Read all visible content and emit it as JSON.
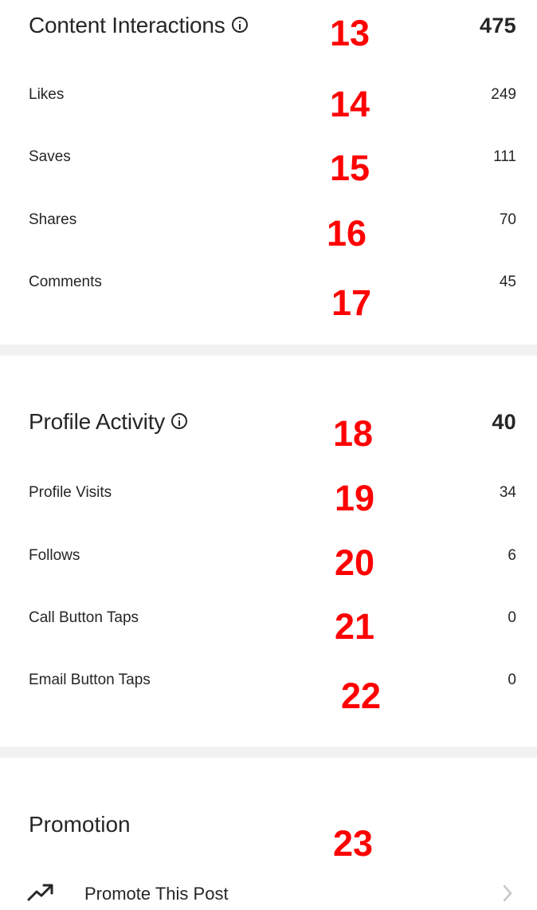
{
  "content_interactions": {
    "title": "Content Interactions",
    "total": "475",
    "items": [
      {
        "label": "Likes",
        "value": "249"
      },
      {
        "label": "Saves",
        "value": "111"
      },
      {
        "label": "Shares",
        "value": "70"
      },
      {
        "label": "Comments",
        "value": "45"
      }
    ]
  },
  "profile_activity": {
    "title": "Profile Activity",
    "total": "40",
    "items": [
      {
        "label": "Profile Visits",
        "value": "34"
      },
      {
        "label": "Follows",
        "value": "6"
      },
      {
        "label": "Call Button Taps",
        "value": "0"
      },
      {
        "label": "Email Button Taps",
        "value": "0"
      }
    ]
  },
  "promotion": {
    "title": "Promotion",
    "promote_label": "Promote This Post"
  },
  "annotations": [
    "13",
    "14",
    "15",
    "16",
    "17",
    "18",
    "19",
    "20",
    "21",
    "22",
    "23"
  ],
  "icons": {
    "info": "info-icon",
    "trend": "trending-up-icon",
    "chevron": "chevron-right-icon"
  },
  "colors": {
    "text": "#262626",
    "annotation": "#ff0000",
    "divider": "#f2f2f2",
    "chevron": "#c7c7c7"
  }
}
